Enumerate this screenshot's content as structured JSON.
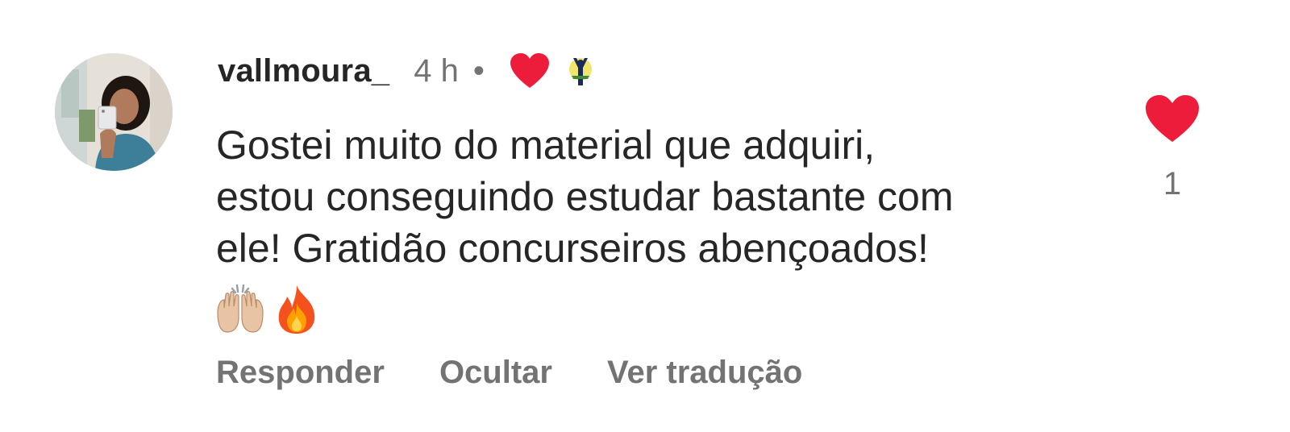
{
  "comment": {
    "username": "vallmoura_",
    "time": "4 h",
    "separator": "•",
    "creator_liked_icon": "heart-icon",
    "creator_badge_icon": "creator-avatar-icon",
    "text": "Gostei muito do material que adquiri,\nestou conseguindo estudar bastante com\nele! Gratidão concurseiros abençoados!",
    "emojis": [
      "raising-hands-emoji",
      "fire-emoji"
    ],
    "actions": {
      "reply": "Responder",
      "hide": "Ocultar",
      "translate": "Ver tradução"
    },
    "like": {
      "icon": "heart-icon",
      "count": "1"
    }
  },
  "colors": {
    "heart": "#ed1c3a",
    "text_primary": "#262626",
    "text_secondary": "#737373"
  }
}
